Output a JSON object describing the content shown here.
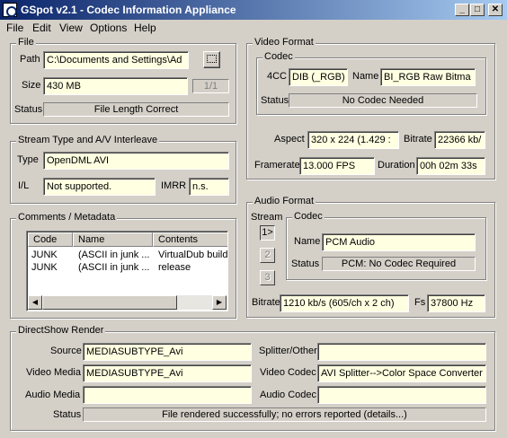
{
  "window": {
    "title": "GSpot v2.1 - Codec Information Appliance",
    "controls": {
      "minimize": "_",
      "maximize": "□",
      "close": "✕"
    }
  },
  "menu": [
    {
      "label": "File"
    },
    {
      "label": "Edit"
    },
    {
      "label": "View"
    },
    {
      "label": "Options"
    },
    {
      "label": "Help"
    }
  ],
  "file": {
    "legend": "File",
    "path_label": "Path",
    "path": "C:\\Documents and Settings\\Ad",
    "size_label": "Size",
    "size": "430 MB",
    "page": "1/1",
    "status_label": "Status",
    "status": "File Length Correct"
  },
  "stream": {
    "legend": "Stream Type and A/V Interleave",
    "type_label": "Type",
    "type": "OpenDML AVI",
    "il_label": "I/L",
    "il": "Not supported.",
    "imrr_label": "IMRR",
    "imrr": "n.s."
  },
  "comments": {
    "legend": "Comments / Metadata",
    "columns": [
      "Code",
      "Name",
      "Contents"
    ],
    "rows": [
      {
        "code": "JUNK",
        "name": "(ASCII in junk ...",
        "contents": "VirtualDub build"
      },
      {
        "code": "JUNK",
        "name": "(ASCII in junk ...",
        "contents": "release"
      }
    ]
  },
  "video": {
    "legend": "Video Format",
    "codec_legend": "Codec",
    "fourcc_label": "4CC",
    "fourcc": "DIB (_RGB)",
    "name_label": "Name",
    "name": "BI_RGB  Raw Bitma",
    "status_label": "Status",
    "status": "No Codec Needed",
    "aspect_label": "Aspect",
    "aspect": "320 x 224  (1.429 :",
    "bitrate_label": "Bitrate",
    "bitrate": "22366 kb/",
    "framerate_label": "Framerate",
    "framerate": "13.000 FPS",
    "duration_label": "Duration",
    "duration": "00h 02m 33s"
  },
  "audio": {
    "legend": "Audio Format",
    "stream_label": "Stream",
    "stream_buttons": [
      "1>",
      "2",
      "3"
    ],
    "codec_legend": "Codec",
    "name_label": "Name",
    "name": "PCM Audio",
    "status_label": "Status",
    "status": "PCM: No Codec Required",
    "bitrate_label": "Bitrate",
    "bitrate": "1210 kb/s (605/ch x 2 ch)",
    "fs_label": "Fs",
    "fs": "37800 Hz"
  },
  "directshow": {
    "legend": "DirectShow Render",
    "source_label": "Source",
    "source": "MEDIASUBTYPE_Avi",
    "splitter_label": "Splitter/Other",
    "splitter": "",
    "video_media_label": "Video Media",
    "video_media": "MEDIASUBTYPE_Avi",
    "video_codec_label": "Video Codec",
    "video_codec": "AVI Splitter-->Color Space Converter",
    "audio_media_label": "Audio Media",
    "audio_media": "",
    "audio_codec_label": "Audio Codec",
    "audio_codec": "",
    "status_label": "Status",
    "status": "File rendered successfully; no errors reported    (details...)"
  },
  "colors": {
    "titlebar_start": "#0a246a",
    "titlebar_end": "#a6caf0",
    "field_background": "#ffffe1",
    "window_background": "#d4d0c8"
  }
}
